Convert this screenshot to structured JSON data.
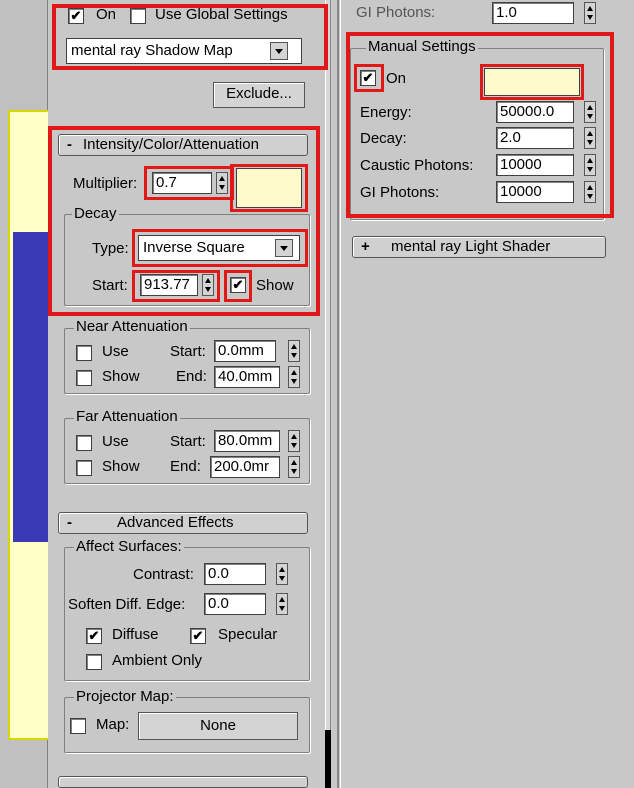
{
  "shadow": {
    "on_checked": true,
    "on_label": "On",
    "use_global_label": "Use Global Settings",
    "type_value": "mental ray Shadow Map",
    "exclude_label": "Exclude..."
  },
  "intensity": {
    "header": "Intensity/Color/Attenuation",
    "header_sign": "-",
    "multiplier_label": "Multiplier:",
    "multiplier_value": "0.7",
    "color": "#fffacc",
    "decay_title": "Decay",
    "type_label": "Type:",
    "type_value": "Inverse Square",
    "start_label": "Start:",
    "start_value": "913.77",
    "show_checked": true,
    "show_label": "Show"
  },
  "near_attenuation": {
    "title": "Near Attenuation",
    "use_label": "Use",
    "show_label": "Show",
    "start_label": "Start:",
    "start_value": "0.0mm",
    "end_label": "End:",
    "end_value": "40.0mm"
  },
  "far_attenuation": {
    "title": "Far Attenuation",
    "use_label": "Use",
    "show_label": "Show",
    "start_label": "Start:",
    "start_value": "80.0mm",
    "end_label": "End:",
    "end_value": "200.0mr"
  },
  "advanced": {
    "header_sign": "-",
    "header": "Advanced Effects",
    "affect_title": "Affect Surfaces:",
    "contrast_label": "Contrast:",
    "contrast_value": "0.0",
    "soften_label": "Soften Diff. Edge:",
    "soften_value": "0.0",
    "diffuse_label": "Diffuse",
    "diffuse_checked": true,
    "specular_label": "Specular",
    "specular_checked": true,
    "ambient_label": "Ambient Only",
    "ambient_checked": false,
    "projector_title": "Projector Map:",
    "map_label": "Map:",
    "map_value": "None"
  },
  "right": {
    "gi_photons_top_label": "GI Photons:",
    "gi_photons_top_value": "1.0",
    "manual_title": "Manual Settings",
    "on_label": "On",
    "on_checked": true,
    "color": "#fffacc",
    "energy_label": "Energy:",
    "energy_value": "50000.0",
    "decay_label": "Decay:",
    "decay_value": "2.0",
    "caustic_label": "Caustic Photons:",
    "caustic_value": "10000",
    "gi_label": "GI Photons:",
    "gi_value": "10000",
    "shader_sign": "+",
    "shader_header": "mental ray Light Shader"
  },
  "colors": {
    "highlight": "#e01818",
    "panel": "#c8c8c8",
    "swatch": "#fffacc"
  }
}
